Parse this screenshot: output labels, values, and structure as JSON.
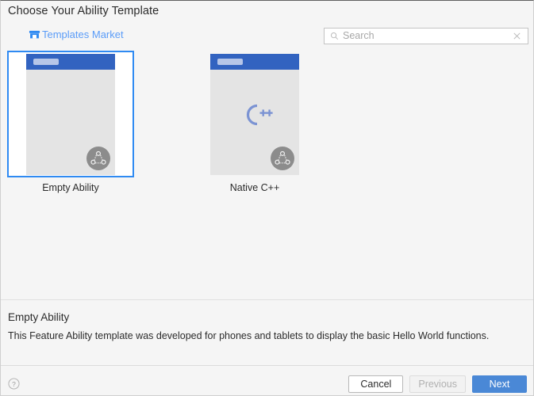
{
  "dialog": {
    "title": "Choose Your Ability Template"
  },
  "market_link": {
    "label": "Templates Market",
    "icon": "shop-icon",
    "color": "#5a9cf8"
  },
  "search": {
    "placeholder": "Search",
    "value": "",
    "search_icon": "search-icon",
    "clear_icon": "clear-icon"
  },
  "templates": [
    {
      "label": "Empty Ability",
      "selected": true,
      "has_cpp_logo": false,
      "badge_icon": "distributed-badge-icon"
    },
    {
      "label": "Native C++",
      "selected": false,
      "has_cpp_logo": true,
      "logo_text": "C++",
      "badge_icon": "distributed-badge-icon"
    }
  ],
  "detail": {
    "title": "Empty Ability",
    "description": "This Feature Ability template was developed for phones and tablets to display the basic Hello World functions."
  },
  "footer": {
    "help_icon": "help-icon",
    "buttons": [
      {
        "label": "Cancel",
        "style": "default",
        "disabled": false
      },
      {
        "label": "Previous",
        "style": "disabled",
        "disabled": true
      },
      {
        "label": "Next",
        "style": "primary",
        "disabled": false
      }
    ]
  },
  "colors": {
    "accent": "#2f8af2",
    "primary_button": "#4a88d6",
    "thumb_titlebar": "#3263c0",
    "link": "#5a9cf8",
    "background": "#f5f5f5"
  }
}
